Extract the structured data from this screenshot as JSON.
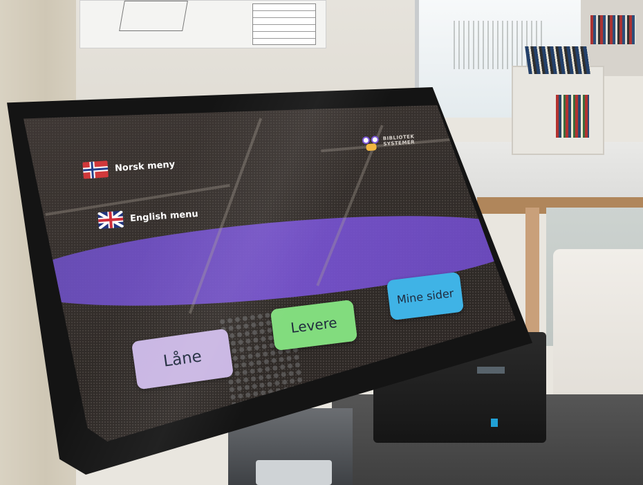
{
  "kiosk": {
    "language_menu": {
      "norwegian_label": "Norsk meny",
      "english_label": "English menu"
    },
    "logo": {
      "line1": "BIBLIOTEK",
      "line2": "SYSTEMER"
    },
    "buttons": {
      "borrow_label": "Låne",
      "return_label": "Levere",
      "my_pages_label": "Mine sider"
    }
  },
  "colors": {
    "borrow_button": "#c9b6e3",
    "return_button": "#82dc7e",
    "my_pages_button": "#3fb3e6",
    "accent_swoosh": "#7a55d6",
    "screen_background": "#3a3431"
  },
  "icons": [
    "norway-flag-icon",
    "uk-flag-icon",
    "owl-logo-icon"
  ]
}
